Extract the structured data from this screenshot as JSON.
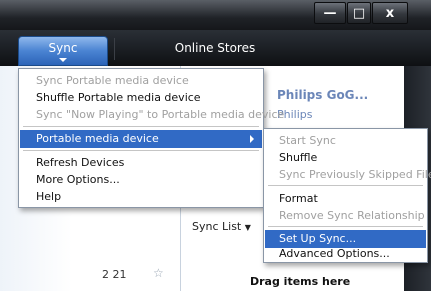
{
  "window": {
    "minimize_label": "—",
    "maximize_label": "□",
    "close_label": "x"
  },
  "tabs": {
    "sync_label": "Sync",
    "online_stores_label": "Online Stores"
  },
  "device_panel": {
    "title": "Philips GoG...",
    "subtitle": "Philips"
  },
  "sync_list_label": "Sync List",
  "drag_hint": "Drag items here",
  "left_pane": {
    "time_text": "2 21",
    "star_icon": "☆"
  },
  "main_menu": {
    "items": [
      {
        "label": "Sync Portable media device",
        "enabled": false
      },
      {
        "label": "Shuffle Portable media device",
        "enabled": true
      },
      {
        "label": "Sync \"Now Playing\" to Portable media device",
        "enabled": false
      },
      {
        "label": "Portable media device",
        "enabled": true,
        "highlighted": true,
        "submenu": true
      },
      {
        "label": "Refresh Devices",
        "enabled": true
      },
      {
        "label": "More Options...",
        "enabled": true
      },
      {
        "label": "Help",
        "enabled": true
      }
    ]
  },
  "submenu": {
    "items": [
      {
        "label": "Start Sync",
        "enabled": false
      },
      {
        "label": "Shuffle",
        "enabled": true
      },
      {
        "label": "Sync Previously Skipped Files",
        "enabled": false
      },
      {
        "label": "Format",
        "enabled": true
      },
      {
        "label": "Remove Sync Relationship",
        "enabled": false
      },
      {
        "label": "Set Up Sync...",
        "enabled": true,
        "highlighted": true
      },
      {
        "label": "Advanced Options...",
        "enabled": true
      }
    ]
  },
  "colors": {
    "highlight": "#316ac5",
    "disabled_text": "#a0a0a0",
    "accent_tab": "#4a83d2"
  }
}
